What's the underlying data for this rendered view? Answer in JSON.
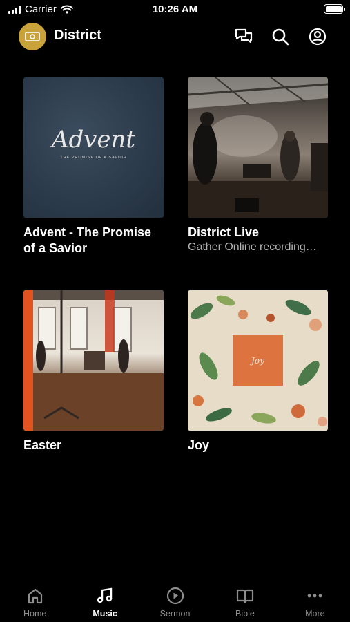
{
  "status_bar": {
    "carrier": "Carrier",
    "time": "10:26 AM"
  },
  "header": {
    "title": "District",
    "icons": [
      "chat-icon",
      "search-icon",
      "account-icon"
    ]
  },
  "albums": [
    {
      "title": "Advent - The Promise of a Savior",
      "subtitle": "",
      "cover_text": "Advent",
      "cover_subtext": "THE PROMISE OF A SAVIOR"
    },
    {
      "title": "District Live",
      "subtitle": "Gather Online recording…"
    },
    {
      "title": "Easter",
      "subtitle": ""
    },
    {
      "title": "Joy",
      "subtitle": "",
      "cover_text": "Joy"
    }
  ],
  "tabs": [
    {
      "label": "Home",
      "icon": "home-icon",
      "active": false
    },
    {
      "label": "Music",
      "icon": "music-note-icon",
      "active": true
    },
    {
      "label": "Sermon",
      "icon": "play-circle-icon",
      "active": false
    },
    {
      "label": "Bible",
      "icon": "book-icon",
      "active": false
    },
    {
      "label": "More",
      "icon": "more-dots-icon",
      "active": false
    }
  ],
  "colors": {
    "background": "#000000",
    "logo": "#c9a23a",
    "inactive_tab": "#8e8e8e",
    "joy_accent": "#dd7440"
  }
}
